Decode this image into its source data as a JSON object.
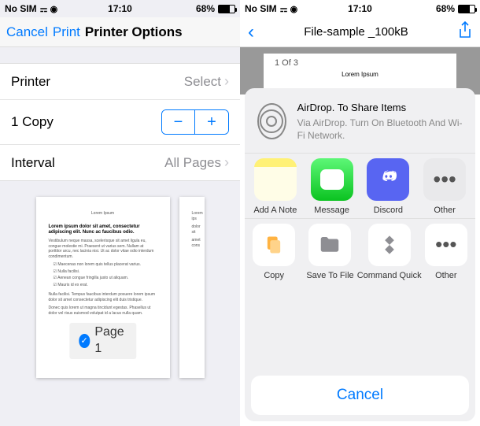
{
  "left": {
    "status": {
      "carrier": "No SIM",
      "time": "17:10",
      "battery": "68%"
    },
    "nav": {
      "cancel": "Cancel",
      "print": "Print",
      "title": "Printer Options"
    },
    "rows": {
      "printer_label": "Printer",
      "printer_value": "Select",
      "copies_value": "1 Copy",
      "interval_label": "Interval",
      "interval_value": "All Pages"
    },
    "preview": {
      "page_label": "Page 1",
      "lorem_header": "Lorem Ipsum"
    }
  },
  "right": {
    "status": {
      "carrier": "No SIM",
      "time": "17:10",
      "battery": "68%"
    },
    "nav": {
      "filename": "File-sample _100kB"
    },
    "doc": {
      "page_of": "1 Of 3",
      "lorem": "Lorem Ipsum"
    },
    "sheet": {
      "airdrop_title": "AirDrop. To Share Items",
      "airdrop_sub": "Via AirDrop. Turn On Bluetooth And Wi-Fi Network.",
      "apps": {
        "notes": "Add A Note",
        "message": "Message",
        "discord": "Discord",
        "other": "Other"
      },
      "actions": {
        "copy": "Copy",
        "save": "Save To File",
        "command": "Command Quick",
        "other": "Other"
      },
      "cancel": "Cancel"
    }
  }
}
